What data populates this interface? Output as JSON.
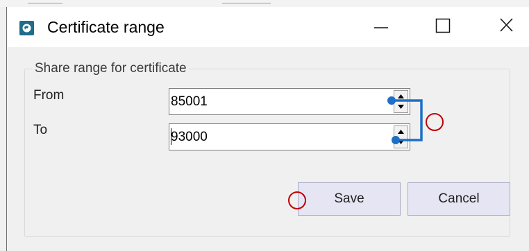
{
  "window": {
    "title": "Certificate range",
    "icon": "app-icon",
    "controls": [
      "minimize-icon",
      "maximize-icon",
      "close-icon"
    ]
  },
  "group": {
    "legend": "Share range for certificate"
  },
  "fields": {
    "from": {
      "label": "From",
      "value": "85001"
    },
    "to": {
      "label": "To",
      "value": "93000"
    }
  },
  "buttons": {
    "save_label": "Save",
    "cancel_label": "Cancel"
  },
  "colors": {
    "annotation_blue": "#1f6fc5",
    "annotation_red": "#c00000",
    "button_face": "#e5e5f4"
  }
}
